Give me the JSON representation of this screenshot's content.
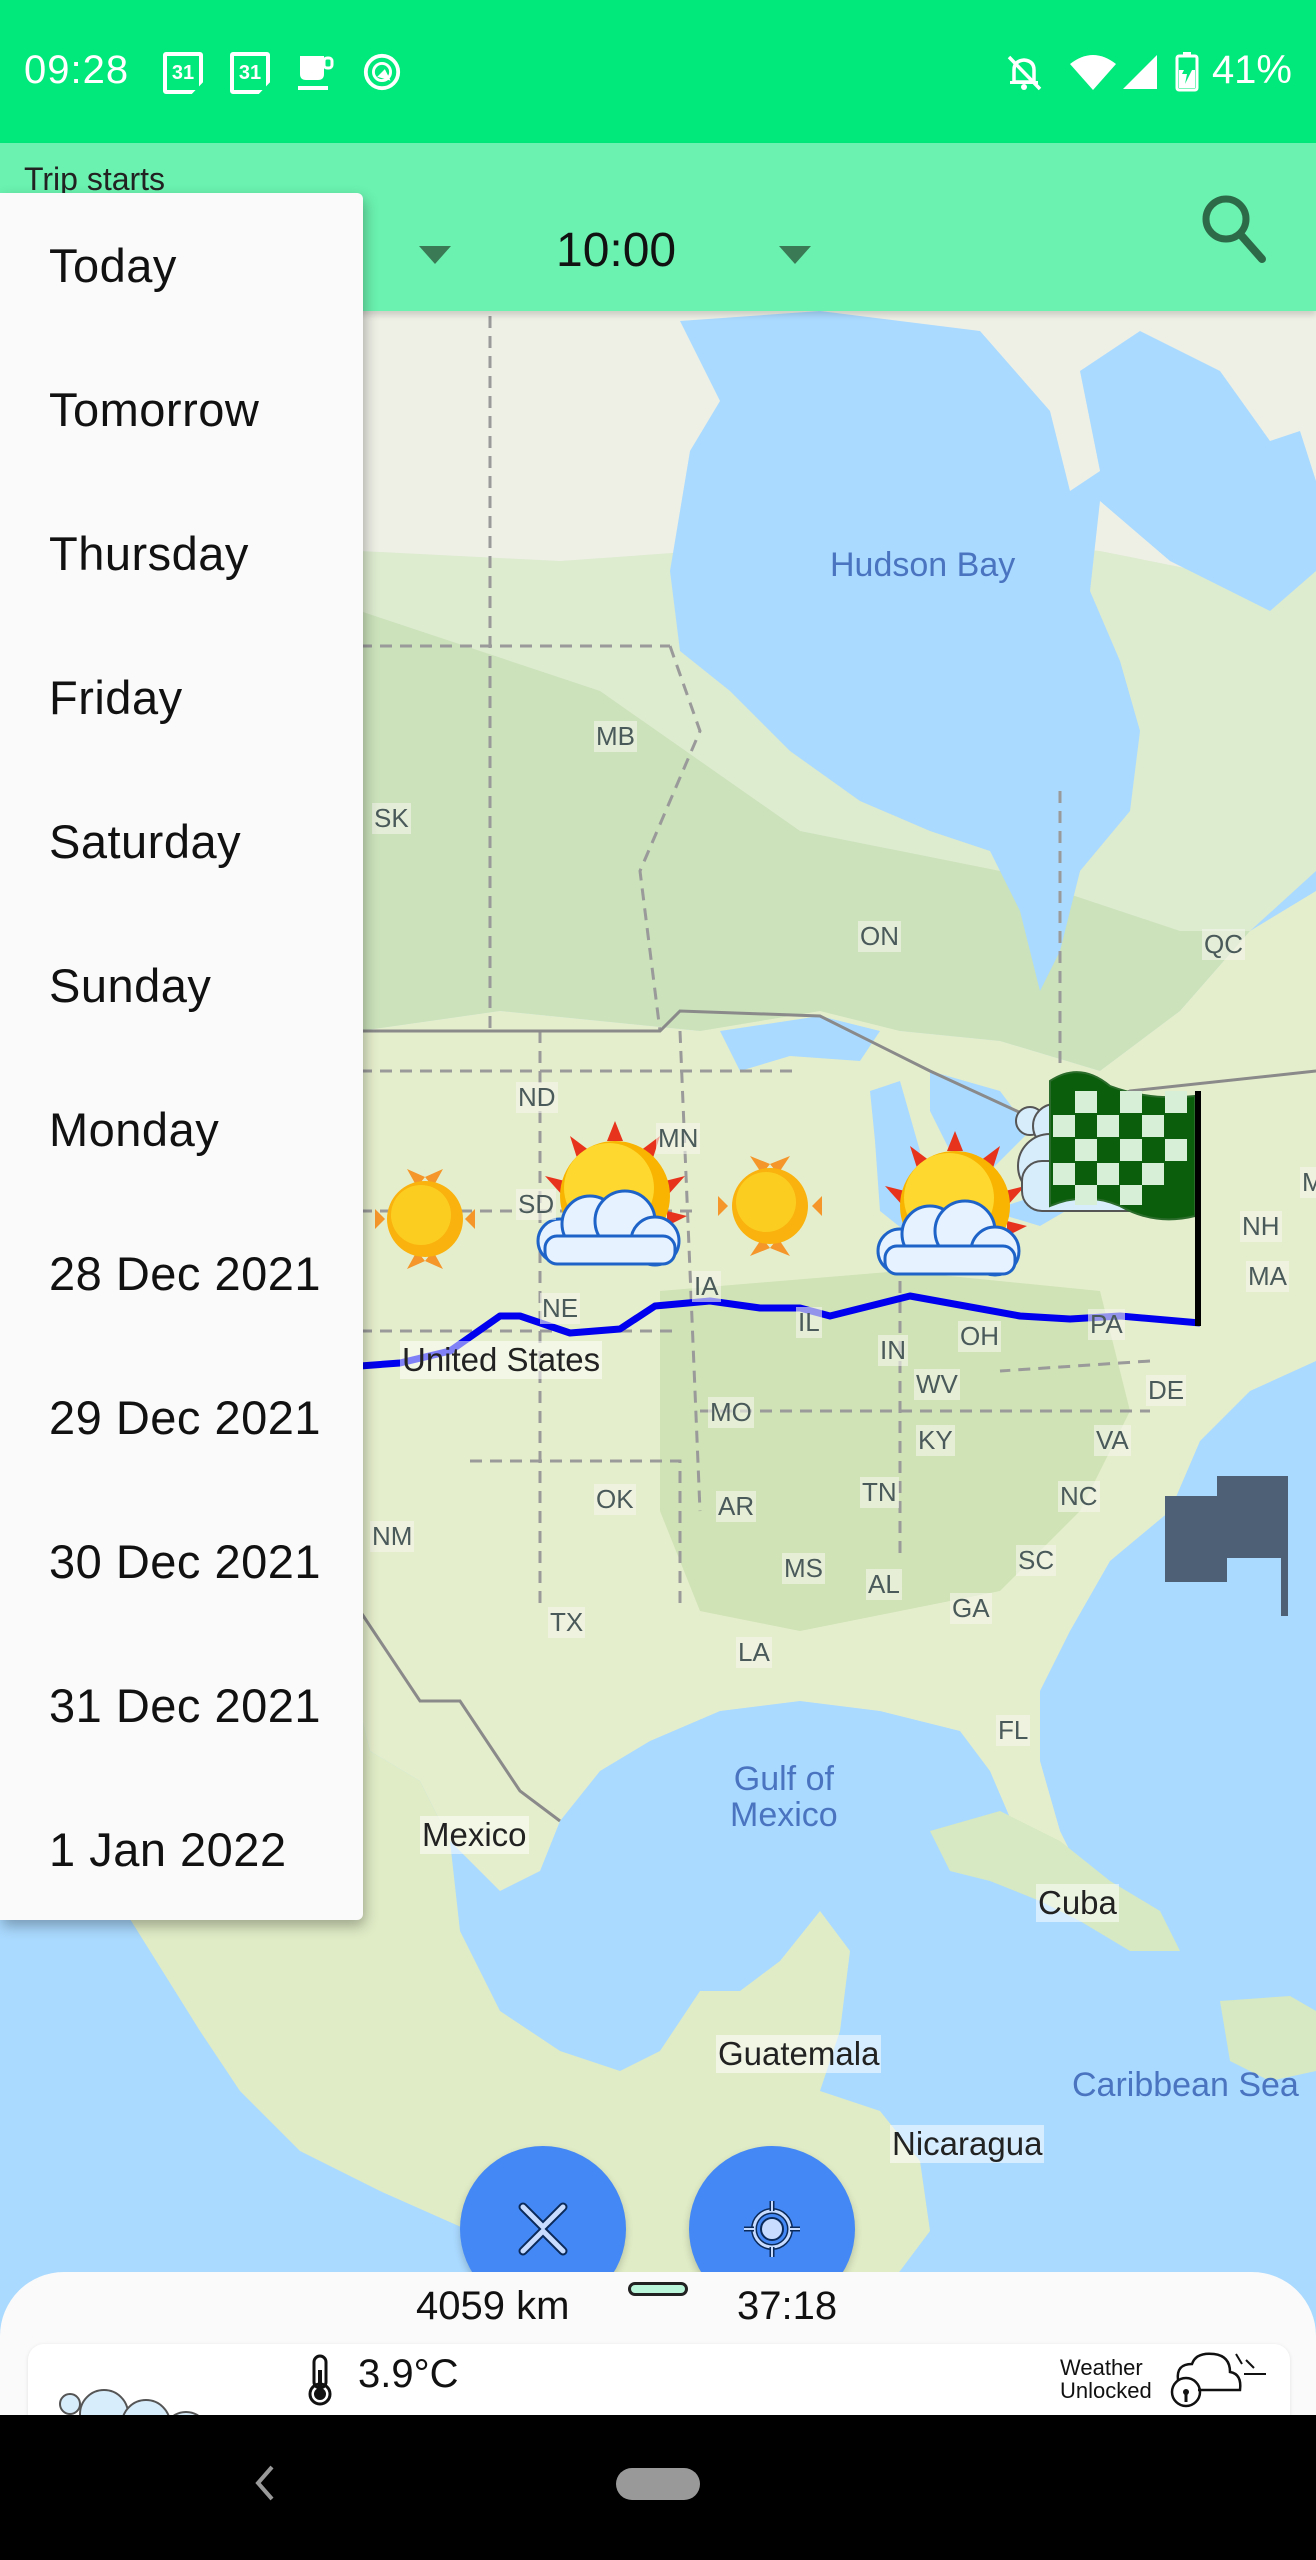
{
  "status_bar": {
    "time": "09:28",
    "left_icons": [
      "calendar-31-icon",
      "calendar-31-icon",
      "coffee-cup-icon",
      "android-q-icon"
    ],
    "calendar_day": "31",
    "right_icons": [
      "bell-off-icon",
      "wifi-icon",
      "cellular-signal-icon",
      "battery-charging-icon"
    ],
    "battery_percent": "41%",
    "background_color": "#00E97A"
  },
  "header": {
    "label": "Trip starts",
    "date_selector": {
      "selected": "Today"
    },
    "time_selector": {
      "selected": "10:00"
    },
    "search_icon": "search-icon",
    "background_color": "#6BF2B0"
  },
  "date_menu": {
    "items": [
      {
        "label": "Today"
      },
      {
        "label": "Tomorrow"
      },
      {
        "label": "Thursday"
      },
      {
        "label": "Friday"
      },
      {
        "label": "Saturday"
      },
      {
        "label": "Sunday"
      },
      {
        "label": "Monday"
      },
      {
        "label": "28 Dec 2021"
      },
      {
        "label": "29 Dec 2021"
      },
      {
        "label": "30 Dec 2021"
      },
      {
        "label": "31 Dec 2021"
      },
      {
        "label": "1 Jan 2022"
      }
    ]
  },
  "map": {
    "labels": {
      "hudson_bay": "Hudson Bay",
      "gulf_line1": "Gulf of",
      "gulf_line2": "Mexico",
      "caribbean": "Caribbean Sea",
      "united_states": "United States",
      "mexico": "Mexico",
      "cuba": "Cuba",
      "guatemala": "Guatemala",
      "nicaragua": "Nicaragua",
      "mb": "MB",
      "sk": "SK",
      "on": "ON",
      "qc": "QC",
      "nd": "ND",
      "sd": "SD",
      "mn": "MN",
      "ne": "NE",
      "ia": "IA",
      "il": "IL",
      "in": "IN",
      "oh": "OH",
      "pa": "PA",
      "nh": "NH",
      "ma": "MA",
      "me": "M",
      "mo": "MO",
      "ky": "KY",
      "wv": "WV",
      "va": "VA",
      "de": "DE",
      "ok": "OK",
      "ar": "AR",
      "tn": "TN",
      "nc": "NC",
      "nm": "NM",
      "ms": "MS",
      "al": "AL",
      "sc": "SC",
      "ga": "GA",
      "tx": "TX",
      "la": "LA",
      "fl": "FL"
    },
    "route_color": "#0000EE",
    "weather_markers": [
      "sunny-icon",
      "partly-cloudy-icon",
      "sunny-icon",
      "partly-cloudy-icon",
      "cloudy-icon"
    ],
    "destination_marker": "checkered-flag-icon",
    "offscreen_marker": "flag-icon"
  },
  "fabs": {
    "clear": {
      "icon": "close-icon"
    },
    "locate": {
      "icon": "my-location-icon"
    },
    "color": "#4488F5"
  },
  "bottom_sheet": {
    "distance": "4059 km",
    "duration": "37:18",
    "weather": {
      "temperature": "3.9°C",
      "condition_icon": "cloudy-icon",
      "provider_line1": "Weather",
      "provider_line2": "Unlocked"
    }
  },
  "nav_bar": {
    "back_icon": "back-icon",
    "home_icon": "home-pill-icon"
  }
}
